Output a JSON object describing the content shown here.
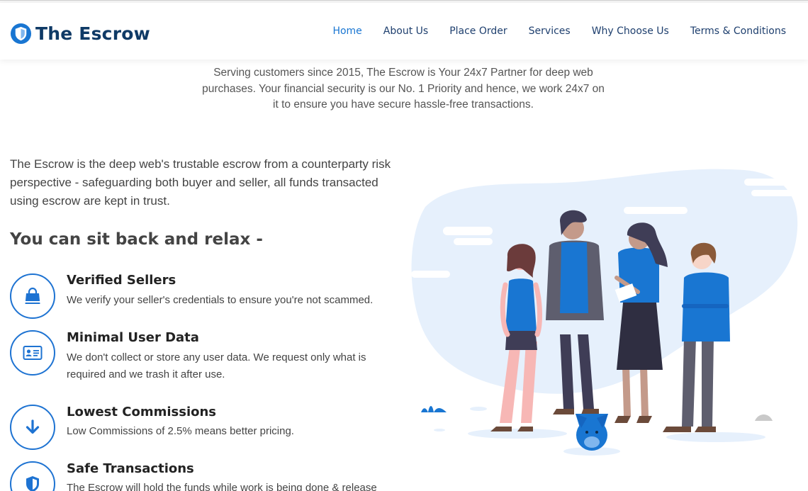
{
  "brand": {
    "name": "The Escrow",
    "accent": "#1976d2",
    "navy": "#0f3a66"
  },
  "nav": {
    "items": [
      {
        "label": "Home",
        "active": true
      },
      {
        "label": "About Us"
      },
      {
        "label": "Place Order"
      },
      {
        "label": "Services"
      },
      {
        "label": "Why Choose Us"
      },
      {
        "label": "Terms & Conditions"
      }
    ]
  },
  "intro": "Serving customers since 2015, The Escrow is Your 24x7 Partner for deep web purchases. Your financial security is our No. 1 Priority and hence, we work 24x7 on it to ensure you have secure hassle-free transactions.",
  "lead": "The Escrow is the deep web's trustable escrow from a counterparty risk perspective - safeguarding both buyer and seller, all funds transacted using escrow are kept in trust.",
  "relax_heading": "You can sit back and relax -",
  "features": [
    {
      "icon": "shopping-bag-icon",
      "title": "Verified Sellers",
      "desc": "We verify your seller's credentials to ensure you're not scammed."
    },
    {
      "icon": "id-card-icon",
      "title": "Minimal User Data",
      "desc": "We don't collect or store any user data. We request only what is required and we trash it after use."
    },
    {
      "icon": "arrow-down-icon",
      "title": "Lowest Commissions",
      "desc": "Low Commissions of 2.5% means better pricing."
    },
    {
      "icon": "shield-icon",
      "title": "Safe Transactions",
      "desc": "The Escrow will hold the funds while work is being done & release"
    }
  ]
}
